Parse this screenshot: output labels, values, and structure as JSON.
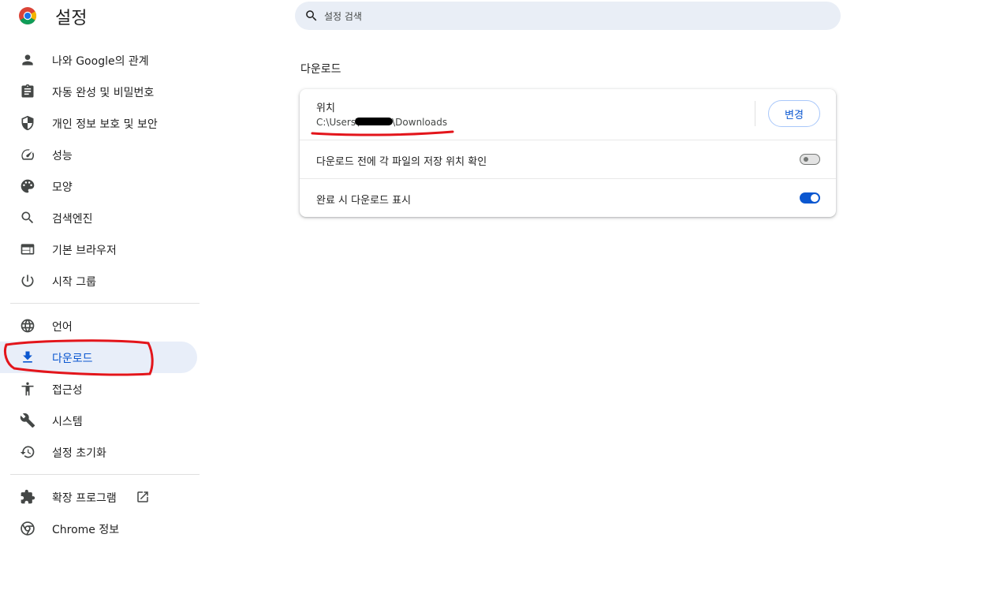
{
  "app": {
    "title": "설정"
  },
  "search": {
    "placeholder": "설정 검색"
  },
  "sidebar": {
    "items": [
      {
        "label": "나와 Google의 관계",
        "icon": "person-icon"
      },
      {
        "label": "자동 완성 및 비밀번호",
        "icon": "clipboard-icon"
      },
      {
        "label": "개인 정보 보호 및 보안",
        "icon": "shield-icon"
      },
      {
        "label": "성능",
        "icon": "speedometer-icon"
      },
      {
        "label": "모양",
        "icon": "palette-icon"
      },
      {
        "label": "검색엔진",
        "icon": "search-icon"
      },
      {
        "label": "기본 브라우저",
        "icon": "browser-icon"
      },
      {
        "label": "시작 그룹",
        "icon": "power-icon"
      },
      {
        "label": "언어",
        "icon": "globe-icon"
      },
      {
        "label": "다운로드",
        "icon": "download-icon",
        "active": true
      },
      {
        "label": "접근성",
        "icon": "accessibility-icon"
      },
      {
        "label": "시스템",
        "icon": "wrench-icon"
      },
      {
        "label": "설정 초기화",
        "icon": "history-icon"
      },
      {
        "label": "확장 프로그램",
        "icon": "puzzle-icon"
      },
      {
        "label": "Chrome 정보",
        "icon": "chrome-icon"
      }
    ]
  },
  "main": {
    "section_title": "다운로드",
    "location": {
      "label": "위치",
      "path_prefix": "C:\\Users\\",
      "path_suffix": "\\Downloads",
      "change_button": "변경"
    },
    "ask_where_to_save": {
      "label": "다운로드 전에 각 파일의 저장 위치 확인",
      "enabled": false
    },
    "show_when_done": {
      "label": "완료 시 다운로드 표시",
      "enabled": true
    }
  },
  "colors": {
    "accent": "#0b57d0",
    "active_bg": "#e8eef9",
    "annotation": "#e3151b"
  }
}
